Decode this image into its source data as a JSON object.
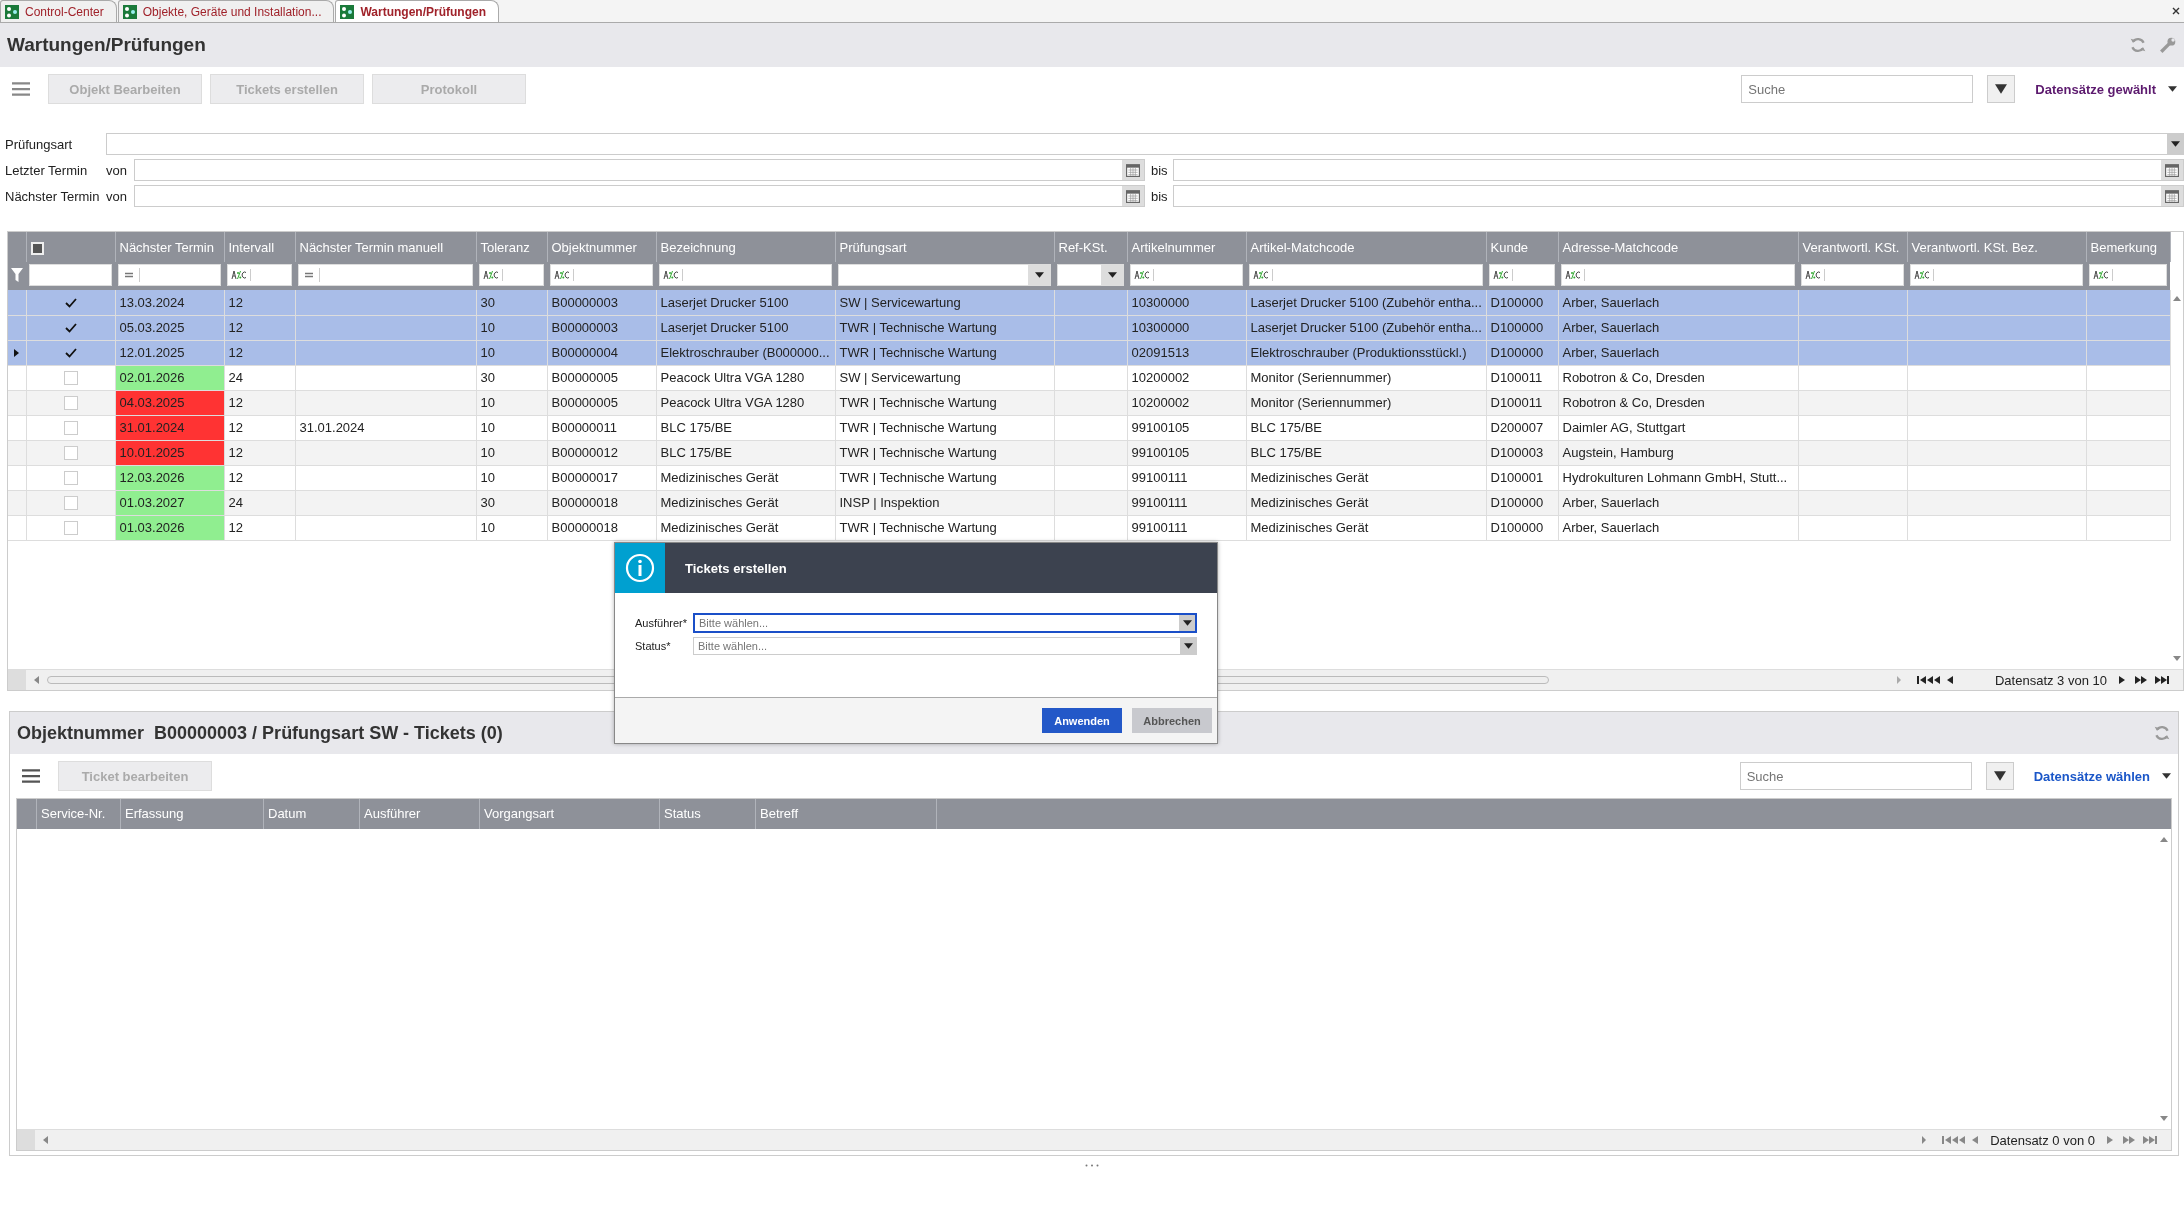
{
  "tabs": [
    {
      "label": "Control-Center",
      "selected": false
    },
    {
      "label": "Objekte, Geräte und Installation...",
      "selected": false
    },
    {
      "label": "Wartungen/Prüfungen",
      "selected": true
    }
  ],
  "title": "Wartungen/Prüfungen",
  "toolbar": {
    "buttons": [
      {
        "label": "Objekt Bearbeiten",
        "disabled": true
      },
      {
        "label": "Tickets erstellen",
        "disabled": true
      },
      {
        "label": "Protokoll",
        "disabled": true
      }
    ],
    "search": {
      "placeholder": "Suche"
    },
    "records_menu": "Datensätze gewählt"
  },
  "filters": {
    "type_label": "Prüfungsart",
    "ranges": [
      {
        "label": "Letzter Termin",
        "von": "von",
        "bis": "bis"
      },
      {
        "label": "Nächster Termin",
        "von": "von",
        "bis": "bis"
      }
    ]
  },
  "grid": {
    "header_checkbox": {
      "indeterminate": true
    },
    "columns": [
      {
        "kind": "check",
        "filter": {
          "kind": "plain"
        }
      },
      {
        "label": "Nächster Termin",
        "kind": "date",
        "filter": {
          "kind": "eq"
        }
      },
      {
        "label": "Intervall",
        "kind": "text",
        "filter": {
          "kind": "abc"
        }
      },
      {
        "label": "Nächster Termin manuell",
        "kind": "text",
        "filter": {
          "kind": "eq"
        }
      },
      {
        "label": "Toleranz",
        "kind": "text",
        "filter": {
          "kind": "abc"
        }
      },
      {
        "label": "Objektnummer",
        "kind": "text",
        "filter": {
          "kind": "abc"
        }
      },
      {
        "label": "Bezeichnung",
        "kind": "text",
        "filter": {
          "kind": "abc"
        }
      },
      {
        "label": "Prüfungsart",
        "kind": "text",
        "filter": {
          "kind": "select"
        }
      },
      {
        "label": "Ref-KSt.",
        "kind": "text",
        "filter": {
          "kind": "select"
        }
      },
      {
        "label": "Artikelnummer",
        "kind": "text",
        "filter": {
          "kind": "abc"
        }
      },
      {
        "label": "Artikel-Matchcode",
        "kind": "text",
        "filter": {
          "kind": "abc"
        }
      },
      {
        "label": "Kunde",
        "kind": "text",
        "filter": {
          "kind": "abc"
        }
      },
      {
        "label": "Adresse-Matchcode",
        "kind": "text",
        "filter": {
          "kind": "abc"
        }
      },
      {
        "label": "Verantwortl. KSt.",
        "kind": "text",
        "filter": {
          "kind": "abc"
        }
      },
      {
        "label": "Verantwortl. KSt. Bez.",
        "kind": "text",
        "filter": {
          "kind": "abc"
        }
      },
      {
        "label": "Bemerkung",
        "kind": "text",
        "filter": {
          "kind": "abc"
        }
      }
    ],
    "rows": [
      {
        "selected": true,
        "current": false,
        "checked": true,
        "cells": [
          "",
          "13.03.2024",
          "12",
          "",
          "30",
          "B00000003",
          "Laserjet Drucker 5100",
          "SW | Servicewartung",
          "",
          "10300000",
          "Laserjet Drucker 5100 (Zubehör entha...",
          "D100000",
          "Arber, Sauerlach",
          "",
          "",
          ""
        ]
      },
      {
        "selected": true,
        "current": false,
        "checked": true,
        "cells": [
          "",
          "05.03.2025",
          "12",
          "",
          "10",
          "B00000003",
          "Laserjet Drucker 5100",
          "TWR | Technische Wartung",
          "",
          "10300000",
          "Laserjet Drucker 5100 (Zubehör entha...",
          "D100000",
          "Arber, Sauerlach",
          "",
          "",
          ""
        ]
      },
      {
        "selected": true,
        "current": true,
        "checked": true,
        "cells": [
          "",
          "12.01.2025",
          "12",
          "",
          "10",
          "B00000004",
          "Elektroschrauber (B000000...",
          "TWR | Technische Wartung",
          "",
          "02091513",
          "Elektroschrauber (Produktionsstückl.)",
          "D100000",
          "Arber, Sauerlach",
          "",
          "",
          ""
        ]
      },
      {
        "selected": false,
        "current": false,
        "checked": false,
        "color": "#90ee90",
        "cells": [
          "",
          "02.01.2026",
          "24",
          "",
          "30",
          "B00000005",
          "Peacock Ultra VGA 1280",
          "SW | Servicewartung",
          "",
          "10200002",
          "Monitor (Seriennummer)",
          "D100011",
          "Robotron & Co, Dresden",
          "",
          "",
          ""
        ]
      },
      {
        "selected": false,
        "current": false,
        "checked": false,
        "color": "#ff3333",
        "cells": [
          "",
          "04.03.2025",
          "12",
          "",
          "10",
          "B00000005",
          "Peacock Ultra VGA 1280",
          "TWR | Technische Wartung",
          "",
          "10200002",
          "Monitor (Seriennummer)",
          "D100011",
          "Robotron & Co, Dresden",
          "",
          "",
          ""
        ]
      },
      {
        "selected": false,
        "current": false,
        "checked": false,
        "color": "#ff3333",
        "cells": [
          "",
          "31.01.2024",
          "12",
          "31.01.2024",
          "10",
          "B00000011",
          "BLC 175/BE",
          "TWR | Technische Wartung",
          "",
          "99100105",
          "BLC 175/BE",
          "D200007",
          "Daimler AG, Stuttgart",
          "",
          "",
          ""
        ]
      },
      {
        "selected": false,
        "current": false,
        "checked": false,
        "color": "#ff3333",
        "cells": [
          "",
          "10.01.2025",
          "12",
          "",
          "10",
          "B00000012",
          "BLC 175/BE",
          "TWR | Technische Wartung",
          "",
          "99100105",
          "BLC 175/BE",
          "D100003",
          "Augstein, Hamburg",
          "",
          "",
          ""
        ]
      },
      {
        "selected": false,
        "current": false,
        "checked": false,
        "color": "#90ee90",
        "cells": [
          "",
          "12.03.2026",
          "12",
          "",
          "10",
          "B00000017",
          "Medizinisches Gerät",
          "TWR | Technische Wartung",
          "",
          "99100111",
          "Medizinisches Gerät",
          "D100001",
          "Hydrokulturen Lohmann GmbH, Stutt...",
          "",
          "",
          ""
        ]
      },
      {
        "selected": false,
        "current": false,
        "checked": false,
        "color": "#90ee90",
        "cells": [
          "",
          "01.03.2027",
          "24",
          "",
          "30",
          "B00000018",
          "Medizinisches Gerät",
          "INSP | Inspektion",
          "",
          "99100111",
          "Medizinisches Gerät",
          "D100000",
          "Arber, Sauerlach",
          "",
          "",
          ""
        ]
      },
      {
        "selected": false,
        "current": false,
        "checked": false,
        "color": "#90ee90",
        "cells": [
          "",
          "01.03.2026",
          "12",
          "",
          "10",
          "B00000018",
          "Medizinisches Gerät",
          "TWR | Technische Wartung",
          "",
          "99100111",
          "Medizinisches Gerät",
          "D100000",
          "Arber, Sauerlach",
          "",
          "",
          ""
        ]
      }
    ],
    "pager": "Datensatz 3 von 10"
  },
  "tickets": {
    "title": "Objektnummer  B00000003 / Prüfungsart SW - Tickets (0)",
    "button": {
      "label": "Ticket bearbeiten",
      "disabled": true
    },
    "search": {
      "placeholder": "Suche"
    },
    "records_menu": "Datensätze wählen",
    "columns": [
      "Service-Nr.",
      "Erfassung",
      "Datum",
      "Ausführer",
      "Vorgangsart",
      "Status",
      "Betreff"
    ],
    "pager": "Datensatz 0 von 0"
  },
  "dialog": {
    "title": "Tickets erstellen",
    "fields": [
      {
        "label": "Ausführer*",
        "placeholder": "Bitte wählen...",
        "focused": true
      },
      {
        "label": "Status*",
        "placeholder": "Bitte wählen...",
        "focused": false
      }
    ],
    "buttons": [
      {
        "label": "Anwenden",
        "kind": "primary"
      },
      {
        "label": "Abbrechen",
        "kind": "secondary"
      }
    ]
  }
}
